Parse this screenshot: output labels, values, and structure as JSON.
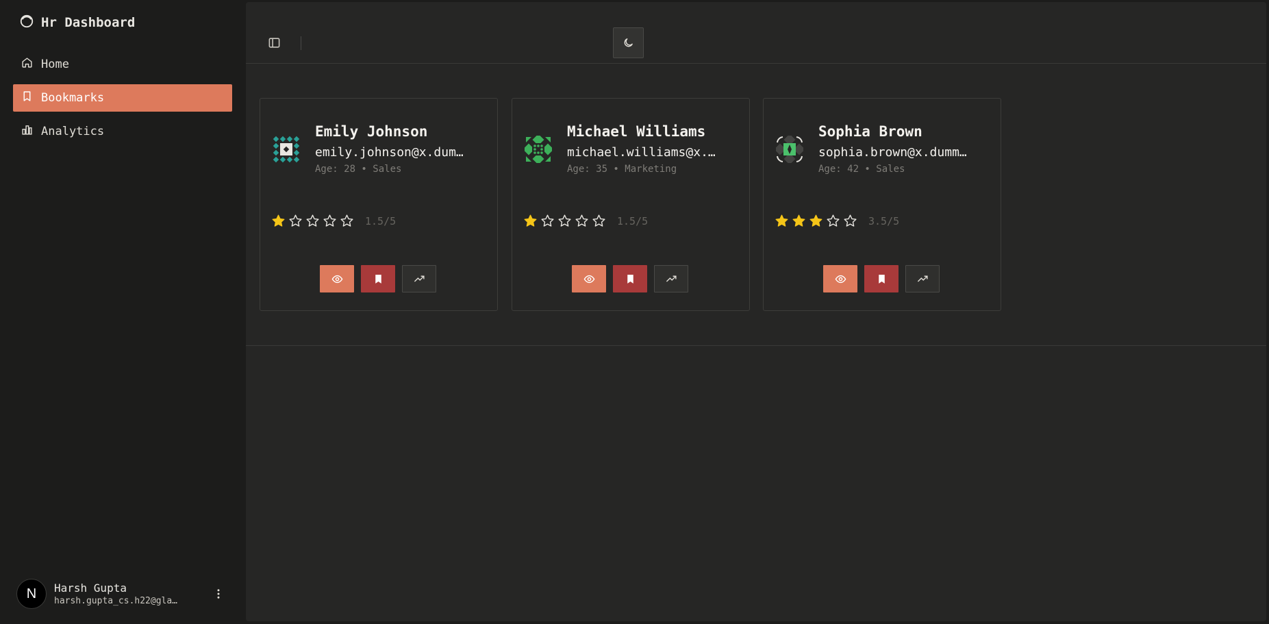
{
  "sidebar": {
    "brand": "Hr Dashboard",
    "items": [
      {
        "label": "Home",
        "icon": "home-icon",
        "active": false
      },
      {
        "label": "Bookmarks",
        "icon": "bookmark-icon",
        "active": true
      },
      {
        "label": "Analytics",
        "icon": "bar-chart-icon",
        "active": false
      }
    ],
    "user": {
      "avatar_letter": "N",
      "name": "Harsh Gupta",
      "email": "harsh.gupta_cs.h22@gla…"
    }
  },
  "topbar": {
    "toggle_icon": "sidebar-toggle-icon",
    "theme_icon": "moon-icon"
  },
  "cards": [
    {
      "name": "Emily Johnson",
      "email": "emily.johnson@x.dum…",
      "meta": "Age: 28 • Sales",
      "rating_value": 1.5,
      "rating_text": "1.5/5",
      "identicon_color": "#2aa198"
    },
    {
      "name": "Michael Williams",
      "email": "michael.williams@x.…",
      "meta": "Age: 35 • Marketing",
      "rating_value": 1.5,
      "rating_text": "1.5/5",
      "identicon_color": "#3db05a"
    },
    {
      "name": "Sophia Brown",
      "email": "sophia.brown@x.dumm…",
      "meta": "Age: 42 • Sales",
      "rating_value": 3.5,
      "rating_text": "3.5/5",
      "identicon_color": "#4bc06b"
    }
  ],
  "colors": {
    "accent": "#dd7a5c",
    "bookmark": "#a83a3a",
    "star": "#f5c518"
  }
}
